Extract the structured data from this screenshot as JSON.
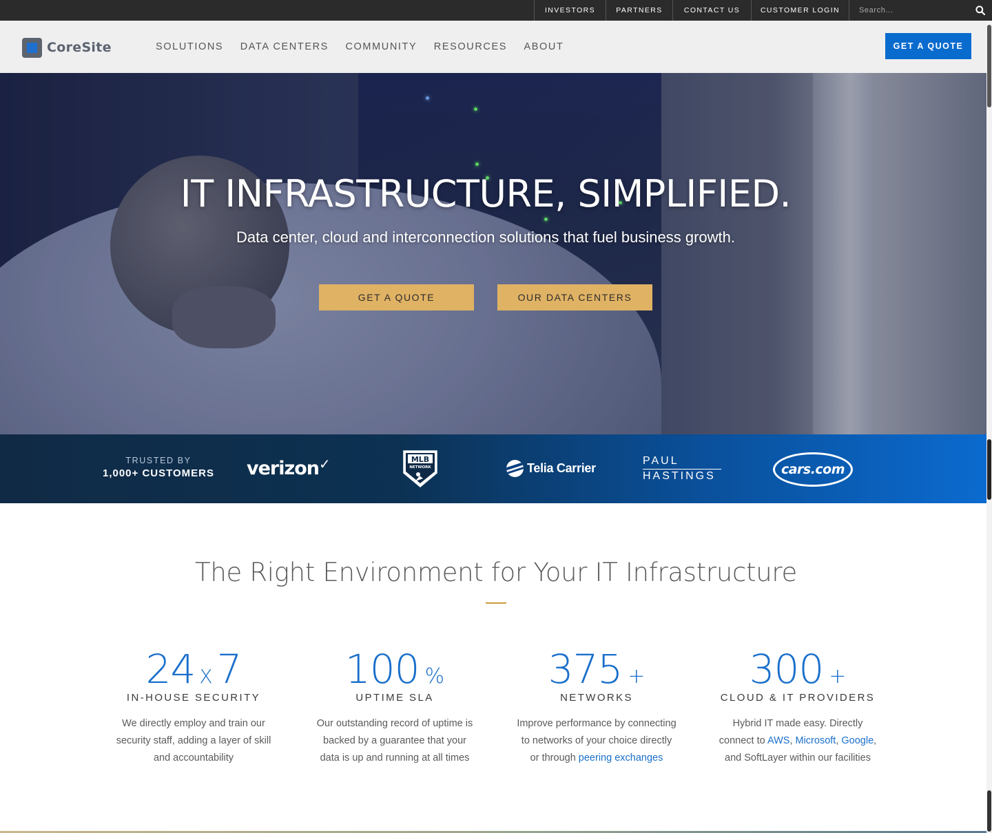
{
  "utility": {
    "links": [
      "INVESTORS",
      "PARTNERS",
      "CONTACT US",
      "CUSTOMER LOGIN"
    ],
    "search_placeholder": "Search..."
  },
  "header": {
    "logo_text": "CoreSite",
    "nav": [
      "SOLUTIONS",
      "DATA CENTERS",
      "COMMUNITY",
      "RESOURCES",
      "ABOUT"
    ],
    "quote_button": "GET A QUOTE"
  },
  "hero": {
    "title": "IT INFRASTRUCTURE, SIMPLIFIED.",
    "subtitle": "Data center, cloud and interconnection solutions that fuel business growth.",
    "buttons": [
      "GET A QUOTE",
      "OUR DATA CENTERS"
    ]
  },
  "trusted": {
    "line1": "TRUSTED BY",
    "line2": "1,000+ CUSTOMERS",
    "logos": {
      "verizon": "verizon",
      "mlb_top": "MLB",
      "mlb_bottom": "NETWORK",
      "telia": "Telia Carrier",
      "paul_1": "PAUL",
      "paul_2": "HASTINGS",
      "cars": "cars.com"
    }
  },
  "section": {
    "title": "The Right Environment for Your IT Infrastructure"
  },
  "stats": [
    {
      "big": "24",
      "small": "X",
      "big2": "7",
      "label": "IN-HOUSE SECURITY",
      "desc_1": "We directly employ and train our",
      "desc_2": "security staff, adding a layer of skill",
      "desc_3": "and accountability"
    },
    {
      "big": "100",
      "suffix": "%",
      "label": "UPTIME SLA",
      "desc_1": "Our outstanding record of uptime is",
      "desc_2": "backed by a guarantee that your",
      "desc_3": "data is up and running at all times"
    },
    {
      "big": "375",
      "suffix": "+",
      "label": "NETWORKS",
      "desc_1": "Improve performance by connecting",
      "desc_2": "to networks of your choice directly",
      "desc_3_pre": "or through ",
      "desc_3_link": "peering exchanges"
    },
    {
      "big": "300",
      "suffix": "+",
      "label": "CLOUD & IT PROVIDERS",
      "desc_1": "Hybrid IT made easy. Directly",
      "desc_2_pre": "connect to ",
      "link_aws": "AWS",
      "sep1": ", ",
      "link_microsoft": "Microsoft",
      "sep2": ", ",
      "link_google": "Google",
      "sep3": ",",
      "desc_3": "and SoftLayer within our facilities"
    }
  ],
  "colors": {
    "accent_blue": "#0a6bce",
    "gold": "#e0b264",
    "rule_gold": "#d29b3a",
    "top_bar": "#2b2b2b"
  }
}
